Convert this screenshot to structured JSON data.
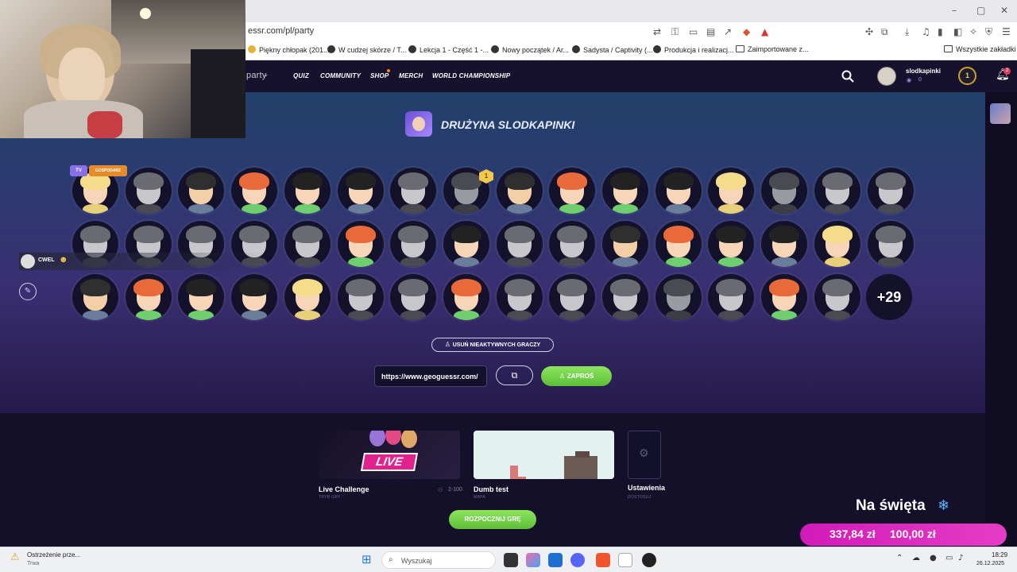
{
  "browser": {
    "url": "essr.com/pl/party",
    "bookmarks": [
      "Piękny chłopak (201...",
      "W cudzej skórze / T...",
      "Lekcja 1 - Część 1 -...",
      "Nowy początek / Ar...",
      "Sadysta / Captivity (...",
      "Produkcja i realizacj...",
      "Zaimportowane z..."
    ],
    "all_bookmarks": "Wszystkie zakładki"
  },
  "nav": {
    "brand": "party",
    "items": [
      "QUIZ",
      "COMMUNITY",
      "SHOP",
      "MERCH",
      "WORLD CHAMPIONSHIP"
    ],
    "username": "slodkapinki",
    "coins": "0",
    "level": "1",
    "notifications": "2"
  },
  "party": {
    "title": "DRUŻYNA SLODKAPINKI",
    "badge_tv": "TV",
    "badge_host": "GOSPODARZ",
    "level_badge": "1",
    "more_count": "+29",
    "remove_inactive": "USUŃ NIEAKTYWNYCH GRACZY",
    "invite_url": "https://www.geoguessr.com/",
    "invite_button": "ZAPROŚ",
    "start_button": "ROZPOCZNIJ GRĘ"
  },
  "chat": {
    "user": "CWEL"
  },
  "modes": [
    {
      "title": "Live Challenge",
      "sub": "TRYB GRY",
      "players": "2-100",
      "image_text": "LIVE"
    },
    {
      "title": "Dumb test",
      "sub": "MAPA"
    },
    {
      "title": "Ustawienia",
      "sub": "DOSTOSUJ"
    }
  ],
  "overlay": {
    "holiday": "Na święta",
    "amount1": "337,84 zł",
    "amount2": "100,00 zł"
  },
  "taskbar": {
    "notif_title": "Ostrzeżenie prze...",
    "notif_status": "Trwa",
    "search": "Wyszukaj",
    "time": "18:29",
    "date": "26.12.2025"
  },
  "colors": {
    "accent_green": "#7ed957",
    "brand_purple": "#2a1a55",
    "overlay_pink": "#d11bb8"
  }
}
